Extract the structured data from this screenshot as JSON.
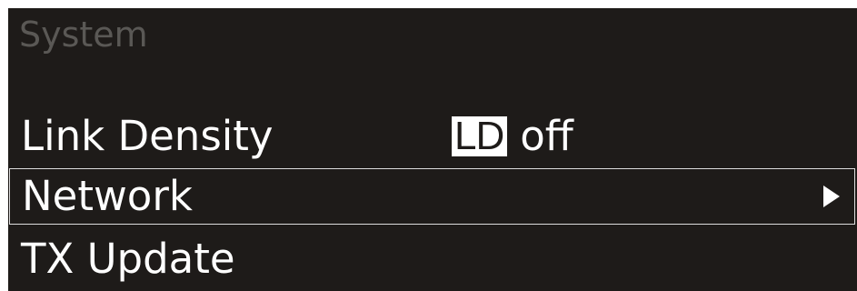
{
  "header": {
    "title": "System"
  },
  "menu": {
    "items": [
      {
        "label": "Link Density",
        "badge": "LD",
        "value": "off"
      },
      {
        "label": "Network",
        "icon": "chevron-right-icon",
        "selected": true
      },
      {
        "label": "TX Update"
      }
    ]
  },
  "colors": {
    "background": "#1e1b19",
    "header_text": "#5a5855",
    "text": "#ffffff",
    "selection_border": "#dcdcdc"
  }
}
